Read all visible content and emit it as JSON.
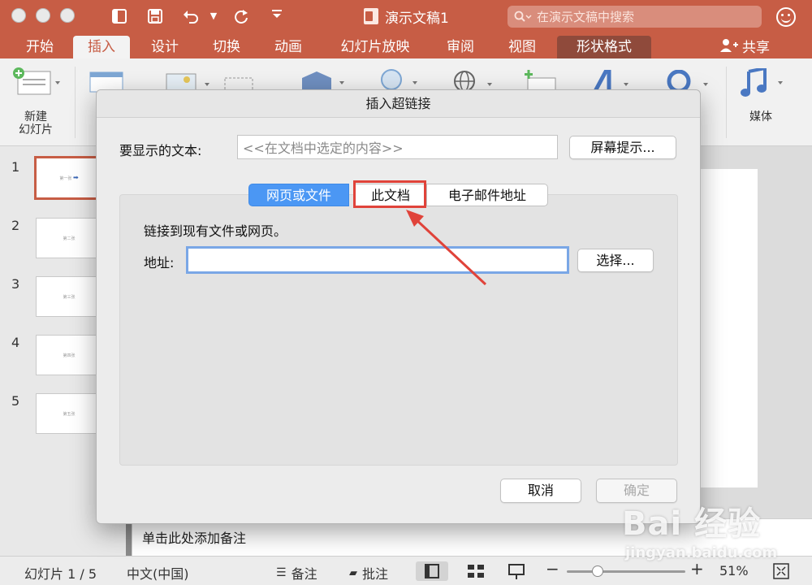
{
  "window": {
    "title": "演示文稿1"
  },
  "search": {
    "placeholder": "在演示文稿中搜索"
  },
  "tabs": [
    {
      "label": "开始"
    },
    {
      "label": "插入"
    },
    {
      "label": "设计"
    },
    {
      "label": "切换"
    },
    {
      "label": "动画"
    },
    {
      "label": "幻灯片放映"
    },
    {
      "label": "审阅"
    },
    {
      "label": "视图"
    },
    {
      "label": "形状格式"
    }
  ],
  "share_label": "共享",
  "ribbon": {
    "new_slide_line1": "新建",
    "new_slide_line2": "幻灯片",
    "media": "媒体"
  },
  "slides": [
    {
      "num": "1",
      "text": "第一张"
    },
    {
      "num": "2",
      "text": "第二张"
    },
    {
      "num": "3",
      "text": "第三张"
    },
    {
      "num": "4",
      "text": "第四张"
    },
    {
      "num": "5",
      "text": "第五张"
    }
  ],
  "notes_placeholder": "单击此处添加备注",
  "status": {
    "slide_count": "幻灯片 1 / 5",
    "language": "中文(中国)",
    "notes": "备注",
    "comments": "批注",
    "zoom": "51%",
    "zoom_fraction": 0.26
  },
  "dialog": {
    "title": "插入超链接",
    "display_text_label": "要显示的文本:",
    "display_text_value": "<<在文档中选定的内容>>",
    "screen_tip_button": "屏幕提示...",
    "tabs": [
      "网页或文件",
      "此文档",
      "电子邮件地址"
    ],
    "panel_heading": "链接到现有文件或网页。",
    "address_label": "地址:",
    "address_value": "",
    "choose_button": "选择...",
    "cancel_button": "取消",
    "ok_button": "确定"
  },
  "watermark": {
    "main": "Bai  经验",
    "url": "jingyan.baidu.com"
  },
  "colors": {
    "accent": "#c75d45",
    "selected_tab": "#4b97f4",
    "highlight": "#e0433a"
  }
}
